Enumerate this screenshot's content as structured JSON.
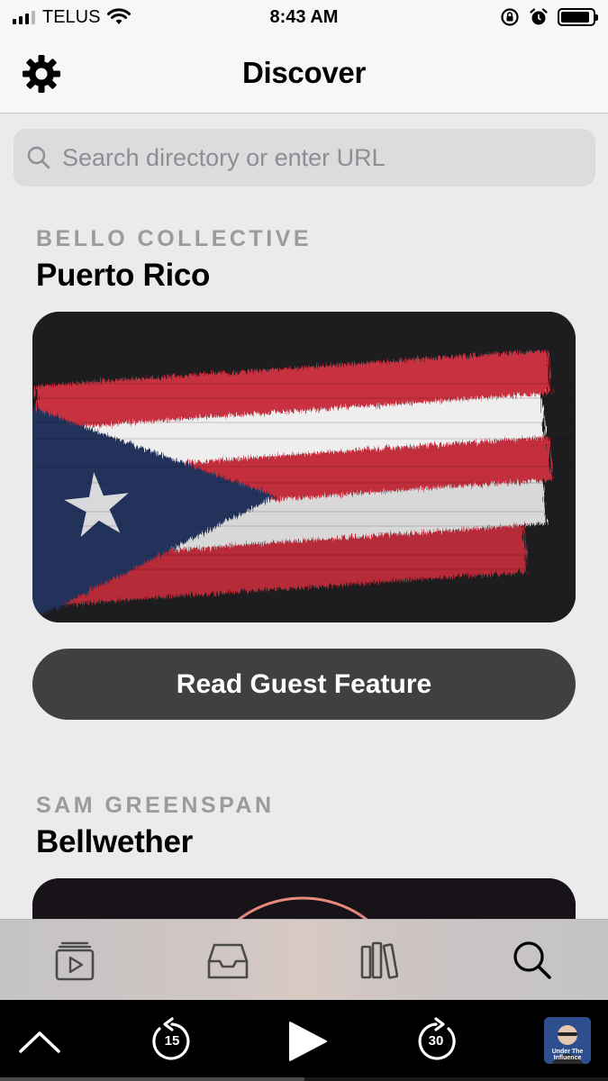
{
  "status_bar": {
    "carrier": "TELUS",
    "time": "8:43 AM",
    "battery_level": 0.9
  },
  "header": {
    "title": "Discover",
    "settings_icon": "gear-icon"
  },
  "search": {
    "placeholder": "Search directory or enter URL"
  },
  "features": [
    {
      "eyebrow": "BELLO COLLECTIVE",
      "title": "Puerto Rico",
      "button_label": "Read Guest Feature"
    },
    {
      "eyebrow": "SAM GREENSPAN",
      "title": "Bellwether"
    }
  ],
  "tab_bar": {
    "items": [
      {
        "icon": "play-queue-icon"
      },
      {
        "icon": "inbox-icon"
      },
      {
        "icon": "library-icon"
      },
      {
        "icon": "search-icon",
        "selected": true
      }
    ]
  },
  "mini_player": {
    "skip_back": "15",
    "skip_forward": "30",
    "artwork_text": "Under The Influence",
    "progress": 0.5
  },
  "colors": {
    "button_bg": "#404040",
    "flag_red": "#c8303f",
    "flag_blue": "#23305a"
  }
}
